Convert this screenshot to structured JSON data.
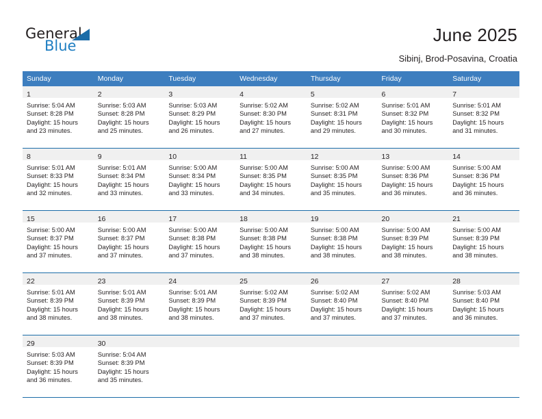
{
  "brand": {
    "name_part1": "General",
    "name_part2": "Blue"
  },
  "header": {
    "title": "June 2025",
    "location": "Sibinj, Brod-Posavina, Croatia"
  },
  "colors": {
    "header_blue": "#3d7ebf",
    "rule_blue": "#1b6ca8",
    "daynum_band": "#f0f0f0",
    "text": "#231f20",
    "logo_blue": "#1f7ec2"
  },
  "weekday_headers": [
    "Sunday",
    "Monday",
    "Tuesday",
    "Wednesday",
    "Thursday",
    "Friday",
    "Saturday"
  ],
  "weeks": [
    [
      {
        "day": "1",
        "sunrise": "Sunrise: 5:04 AM",
        "sunset": "Sunset: 8:28 PM",
        "daylight1": "Daylight: 15 hours",
        "daylight2": "and 23 minutes."
      },
      {
        "day": "2",
        "sunrise": "Sunrise: 5:03 AM",
        "sunset": "Sunset: 8:28 PM",
        "daylight1": "Daylight: 15 hours",
        "daylight2": "and 25 minutes."
      },
      {
        "day": "3",
        "sunrise": "Sunrise: 5:03 AM",
        "sunset": "Sunset: 8:29 PM",
        "daylight1": "Daylight: 15 hours",
        "daylight2": "and 26 minutes."
      },
      {
        "day": "4",
        "sunrise": "Sunrise: 5:02 AM",
        "sunset": "Sunset: 8:30 PM",
        "daylight1": "Daylight: 15 hours",
        "daylight2": "and 27 minutes."
      },
      {
        "day": "5",
        "sunrise": "Sunrise: 5:02 AM",
        "sunset": "Sunset: 8:31 PM",
        "daylight1": "Daylight: 15 hours",
        "daylight2": "and 29 minutes."
      },
      {
        "day": "6",
        "sunrise": "Sunrise: 5:01 AM",
        "sunset": "Sunset: 8:32 PM",
        "daylight1": "Daylight: 15 hours",
        "daylight2": "and 30 minutes."
      },
      {
        "day": "7",
        "sunrise": "Sunrise: 5:01 AM",
        "sunset": "Sunset: 8:32 PM",
        "daylight1": "Daylight: 15 hours",
        "daylight2": "and 31 minutes."
      }
    ],
    [
      {
        "day": "8",
        "sunrise": "Sunrise: 5:01 AM",
        "sunset": "Sunset: 8:33 PM",
        "daylight1": "Daylight: 15 hours",
        "daylight2": "and 32 minutes."
      },
      {
        "day": "9",
        "sunrise": "Sunrise: 5:01 AM",
        "sunset": "Sunset: 8:34 PM",
        "daylight1": "Daylight: 15 hours",
        "daylight2": "and 33 minutes."
      },
      {
        "day": "10",
        "sunrise": "Sunrise: 5:00 AM",
        "sunset": "Sunset: 8:34 PM",
        "daylight1": "Daylight: 15 hours",
        "daylight2": "and 33 minutes."
      },
      {
        "day": "11",
        "sunrise": "Sunrise: 5:00 AM",
        "sunset": "Sunset: 8:35 PM",
        "daylight1": "Daylight: 15 hours",
        "daylight2": "and 34 minutes."
      },
      {
        "day": "12",
        "sunrise": "Sunrise: 5:00 AM",
        "sunset": "Sunset: 8:35 PM",
        "daylight1": "Daylight: 15 hours",
        "daylight2": "and 35 minutes."
      },
      {
        "day": "13",
        "sunrise": "Sunrise: 5:00 AM",
        "sunset": "Sunset: 8:36 PM",
        "daylight1": "Daylight: 15 hours",
        "daylight2": "and 36 minutes."
      },
      {
        "day": "14",
        "sunrise": "Sunrise: 5:00 AM",
        "sunset": "Sunset: 8:36 PM",
        "daylight1": "Daylight: 15 hours",
        "daylight2": "and 36 minutes."
      }
    ],
    [
      {
        "day": "15",
        "sunrise": "Sunrise: 5:00 AM",
        "sunset": "Sunset: 8:37 PM",
        "daylight1": "Daylight: 15 hours",
        "daylight2": "and 37 minutes."
      },
      {
        "day": "16",
        "sunrise": "Sunrise: 5:00 AM",
        "sunset": "Sunset: 8:37 PM",
        "daylight1": "Daylight: 15 hours",
        "daylight2": "and 37 minutes."
      },
      {
        "day": "17",
        "sunrise": "Sunrise: 5:00 AM",
        "sunset": "Sunset: 8:38 PM",
        "daylight1": "Daylight: 15 hours",
        "daylight2": "and 37 minutes."
      },
      {
        "day": "18",
        "sunrise": "Sunrise: 5:00 AM",
        "sunset": "Sunset: 8:38 PM",
        "daylight1": "Daylight: 15 hours",
        "daylight2": "and 38 minutes."
      },
      {
        "day": "19",
        "sunrise": "Sunrise: 5:00 AM",
        "sunset": "Sunset: 8:38 PM",
        "daylight1": "Daylight: 15 hours",
        "daylight2": "and 38 minutes."
      },
      {
        "day": "20",
        "sunrise": "Sunrise: 5:00 AM",
        "sunset": "Sunset: 8:39 PM",
        "daylight1": "Daylight: 15 hours",
        "daylight2": "and 38 minutes."
      },
      {
        "day": "21",
        "sunrise": "Sunrise: 5:00 AM",
        "sunset": "Sunset: 8:39 PM",
        "daylight1": "Daylight: 15 hours",
        "daylight2": "and 38 minutes."
      }
    ],
    [
      {
        "day": "22",
        "sunrise": "Sunrise: 5:01 AM",
        "sunset": "Sunset: 8:39 PM",
        "daylight1": "Daylight: 15 hours",
        "daylight2": "and 38 minutes."
      },
      {
        "day": "23",
        "sunrise": "Sunrise: 5:01 AM",
        "sunset": "Sunset: 8:39 PM",
        "daylight1": "Daylight: 15 hours",
        "daylight2": "and 38 minutes."
      },
      {
        "day": "24",
        "sunrise": "Sunrise: 5:01 AM",
        "sunset": "Sunset: 8:39 PM",
        "daylight1": "Daylight: 15 hours",
        "daylight2": "and 38 minutes."
      },
      {
        "day": "25",
        "sunrise": "Sunrise: 5:02 AM",
        "sunset": "Sunset: 8:39 PM",
        "daylight1": "Daylight: 15 hours",
        "daylight2": "and 37 minutes."
      },
      {
        "day": "26",
        "sunrise": "Sunrise: 5:02 AM",
        "sunset": "Sunset: 8:40 PM",
        "daylight1": "Daylight: 15 hours",
        "daylight2": "and 37 minutes."
      },
      {
        "day": "27",
        "sunrise": "Sunrise: 5:02 AM",
        "sunset": "Sunset: 8:40 PM",
        "daylight1": "Daylight: 15 hours",
        "daylight2": "and 37 minutes."
      },
      {
        "day": "28",
        "sunrise": "Sunrise: 5:03 AM",
        "sunset": "Sunset: 8:40 PM",
        "daylight1": "Daylight: 15 hours",
        "daylight2": "and 36 minutes."
      }
    ],
    [
      {
        "day": "29",
        "sunrise": "Sunrise: 5:03 AM",
        "sunset": "Sunset: 8:39 PM",
        "daylight1": "Daylight: 15 hours",
        "daylight2": "and 36 minutes."
      },
      {
        "day": "30",
        "sunrise": "Sunrise: 5:04 AM",
        "sunset": "Sunset: 8:39 PM",
        "daylight1": "Daylight: 15 hours",
        "daylight2": "and 35 minutes."
      },
      {
        "day": "",
        "sunrise": "",
        "sunset": "",
        "daylight1": "",
        "daylight2": ""
      },
      {
        "day": "",
        "sunrise": "",
        "sunset": "",
        "daylight1": "",
        "daylight2": ""
      },
      {
        "day": "",
        "sunrise": "",
        "sunset": "",
        "daylight1": "",
        "daylight2": ""
      },
      {
        "day": "",
        "sunrise": "",
        "sunset": "",
        "daylight1": "",
        "daylight2": ""
      },
      {
        "day": "",
        "sunrise": "",
        "sunset": "",
        "daylight1": "",
        "daylight2": ""
      }
    ]
  ]
}
